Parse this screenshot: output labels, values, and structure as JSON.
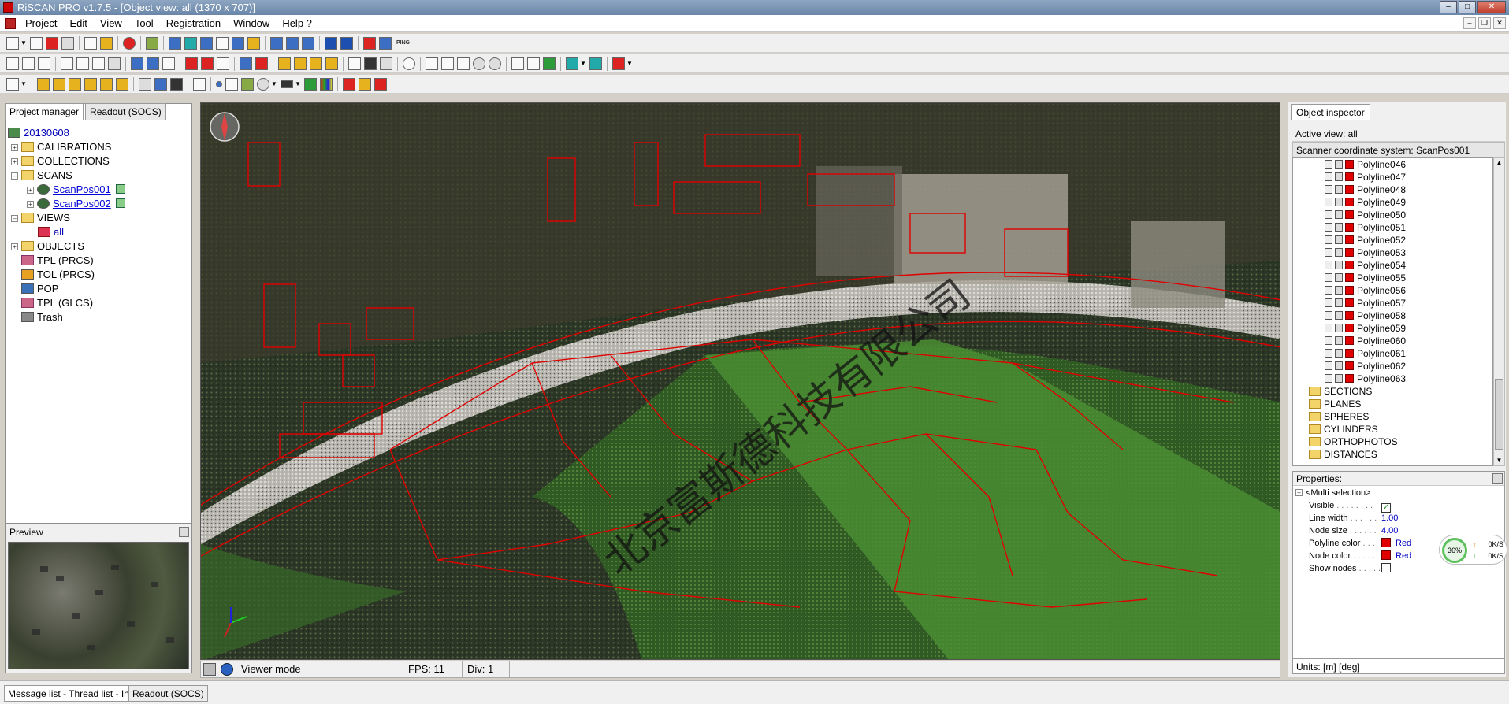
{
  "window": {
    "title": "RiSCAN PRO v1.7.5 - [Object view: all (1370 x 707)]"
  },
  "menu": [
    "Project",
    "Edit",
    "View",
    "Tool",
    "Registration",
    "Window",
    "Help ?"
  ],
  "left": {
    "tabs": [
      "Project manager",
      "Readout (SOCS)"
    ],
    "tree": [
      {
        "label": "20130608",
        "level": 0
      },
      {
        "label": "CALIBRATIONS",
        "level": 1
      },
      {
        "label": "COLLECTIONS",
        "level": 1
      },
      {
        "label": "SCANS",
        "level": 1
      },
      {
        "label": "ScanPos001",
        "level": 2
      },
      {
        "label": "ScanPos002",
        "level": 2
      },
      {
        "label": "VIEWS",
        "level": 1
      },
      {
        "label": "all",
        "level": 2
      },
      {
        "label": "OBJECTS",
        "level": 1
      },
      {
        "label": "TPL (PRCS)",
        "level": 1
      },
      {
        "label": "TOL (PRCS)",
        "level": 1
      },
      {
        "label": "POP",
        "level": 1
      },
      {
        "label": "TPL (GLCS)",
        "level": 1
      },
      {
        "label": "Trash",
        "level": 1
      }
    ],
    "preview_label": "Preview"
  },
  "viewport": {
    "watermark": "北京富斯德科技有限公司"
  },
  "status": {
    "mode": "Viewer mode",
    "fps": "FPS: 11",
    "div": "Div: 1"
  },
  "right": {
    "tab": "Object inspector",
    "active_view": "Active view:  all",
    "coord_system": "Scanner coordinate system: ScanPos001",
    "polylines": [
      "Polyline046",
      "Polyline047",
      "Polyline048",
      "Polyline049",
      "Polyline050",
      "Polyline051",
      "Polyline052",
      "Polyline053",
      "Polyline054",
      "Polyline055",
      "Polyline056",
      "Polyline057",
      "Polyline058",
      "Polyline059",
      "Polyline060",
      "Polyline061",
      "Polyline062",
      "Polyline063"
    ],
    "folders": [
      "SECTIONS",
      "PLANES",
      "SPHERES",
      "CYLINDERS",
      "ORTHOPHOTOS",
      "DISTANCES"
    ],
    "properties_label": "Properties:",
    "properties": {
      "selection": "<Multi selection>",
      "visible_label": "Visible",
      "line_width_label": "Line width",
      "line_width": "1.00",
      "node_size_label": "Node size",
      "node_size": "4.00",
      "polyline_color_label": "Polyline color",
      "polyline_color": "Red",
      "node_color_label": "Node color",
      "node_color": "Red",
      "show_nodes_label": "Show nodes"
    },
    "units": "Units: [m] [deg]"
  },
  "net_widget": {
    "percent": "36%",
    "up": "0K/S",
    "down": "0K/S"
  },
  "bottom_tabs": [
    "Message list - Thread list - Info",
    "Readout (SOCS)"
  ],
  "colors": {
    "polyline": "#e00000",
    "title_bar": "#7a92b2"
  }
}
